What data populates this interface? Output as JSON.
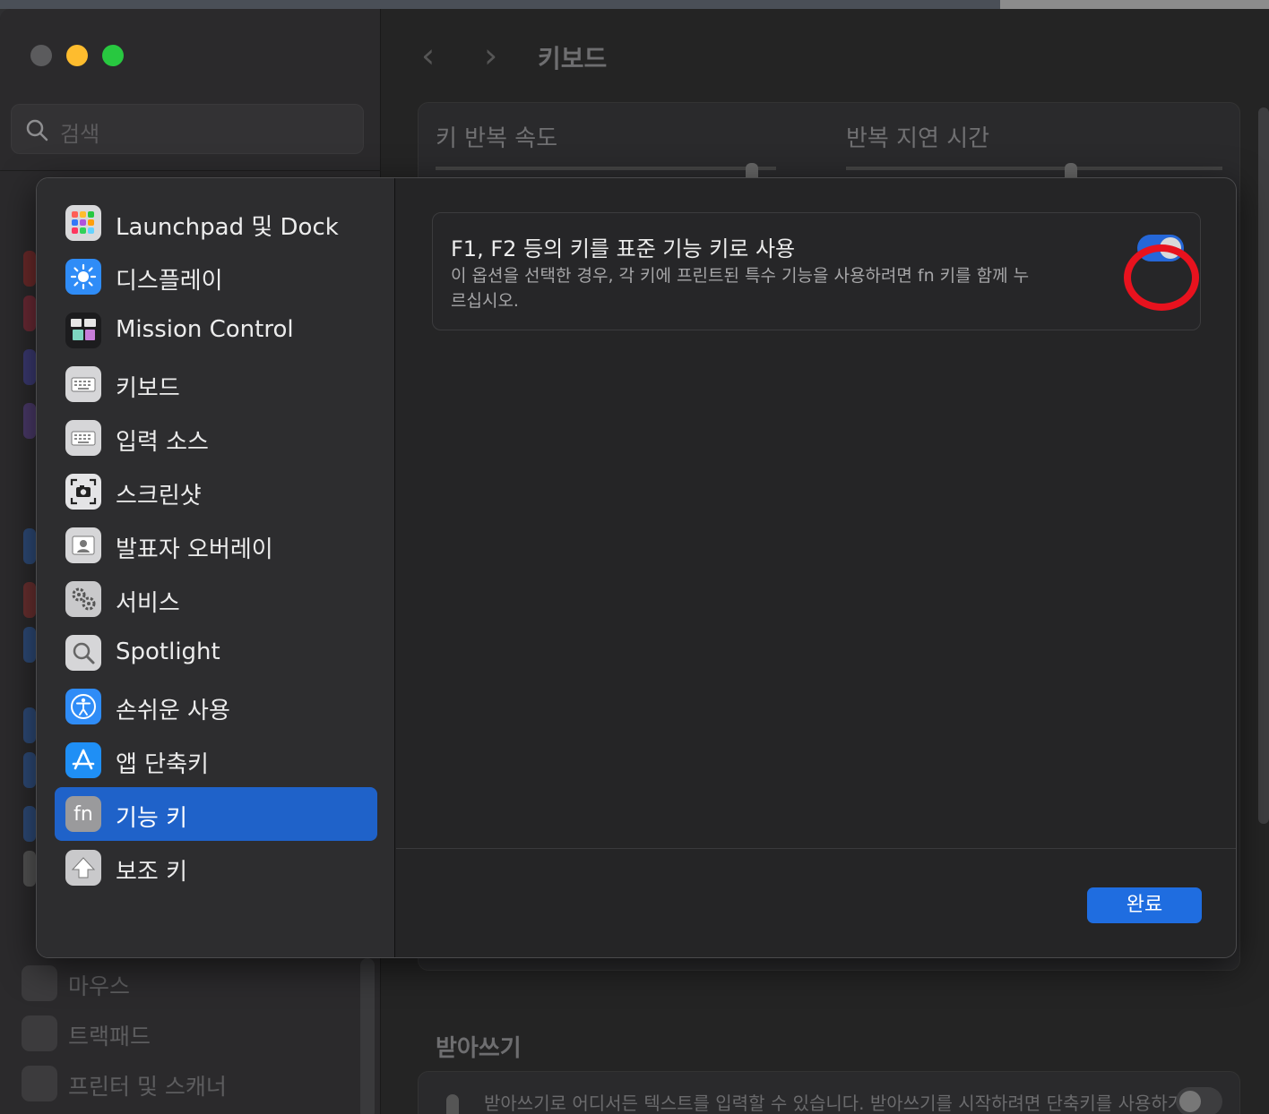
{
  "window": {
    "title": "키보드"
  },
  "search": {
    "placeholder": "검색"
  },
  "sidebar_visible_items": [
    {
      "label": "마우스",
      "icon": "mouse-icon"
    },
    {
      "label": "트랙패드",
      "icon": "trackpad-icon"
    },
    {
      "label": "프린터 및 스캐너",
      "icon": "printer-icon"
    }
  ],
  "background": {
    "key_repeat_label": "키 반복 속도",
    "delay_label": "반복 지연 시간",
    "dictation_title": "받아쓰기",
    "dictation_text": "받아쓰기로 어디서든 텍스트를 입력할 수 있습니다. 받아쓰기를 시작하려면 단축키를 사용하거나"
  },
  "sheet": {
    "nav": [
      {
        "label": "Launchpad 및 Dock",
        "icon": "launchpad-icon"
      },
      {
        "label": "디스플레이",
        "icon": "display-icon"
      },
      {
        "label": "Mission Control",
        "icon": "mission-control-icon"
      },
      {
        "label": "키보드",
        "icon": "keyboard-icon"
      },
      {
        "label": "입력 소스",
        "icon": "input-sources-icon"
      },
      {
        "label": "스크린샷",
        "icon": "screenshot-icon"
      },
      {
        "label": "발표자 오버레이",
        "icon": "presenter-overlay-icon"
      },
      {
        "label": "서비스",
        "icon": "services-icon"
      },
      {
        "label": "Spotlight",
        "icon": "spotlight-icon"
      },
      {
        "label": "손쉬운 사용",
        "icon": "accessibility-icon"
      },
      {
        "label": "앱 단축키",
        "icon": "app-shortcuts-icon"
      },
      {
        "label": "기능 키",
        "icon": "fn-icon",
        "selected": true
      },
      {
        "label": "보조 키",
        "icon": "modifier-keys-icon"
      }
    ],
    "option": {
      "title": "F1, F2 등의 키를 표준 기능 키로 사용",
      "description": "이 옵션을 선택한 경우, 각 키에 프린트된 특수 기능을 사용하려면 fn 키를 함께 누르십시오.",
      "enabled": true
    },
    "fn_icon_text": "fn",
    "done_label": "완료"
  },
  "colors": {
    "accent": "#1f62c9",
    "toggle_on": "#2567d8",
    "highlight": "#e8121e"
  }
}
